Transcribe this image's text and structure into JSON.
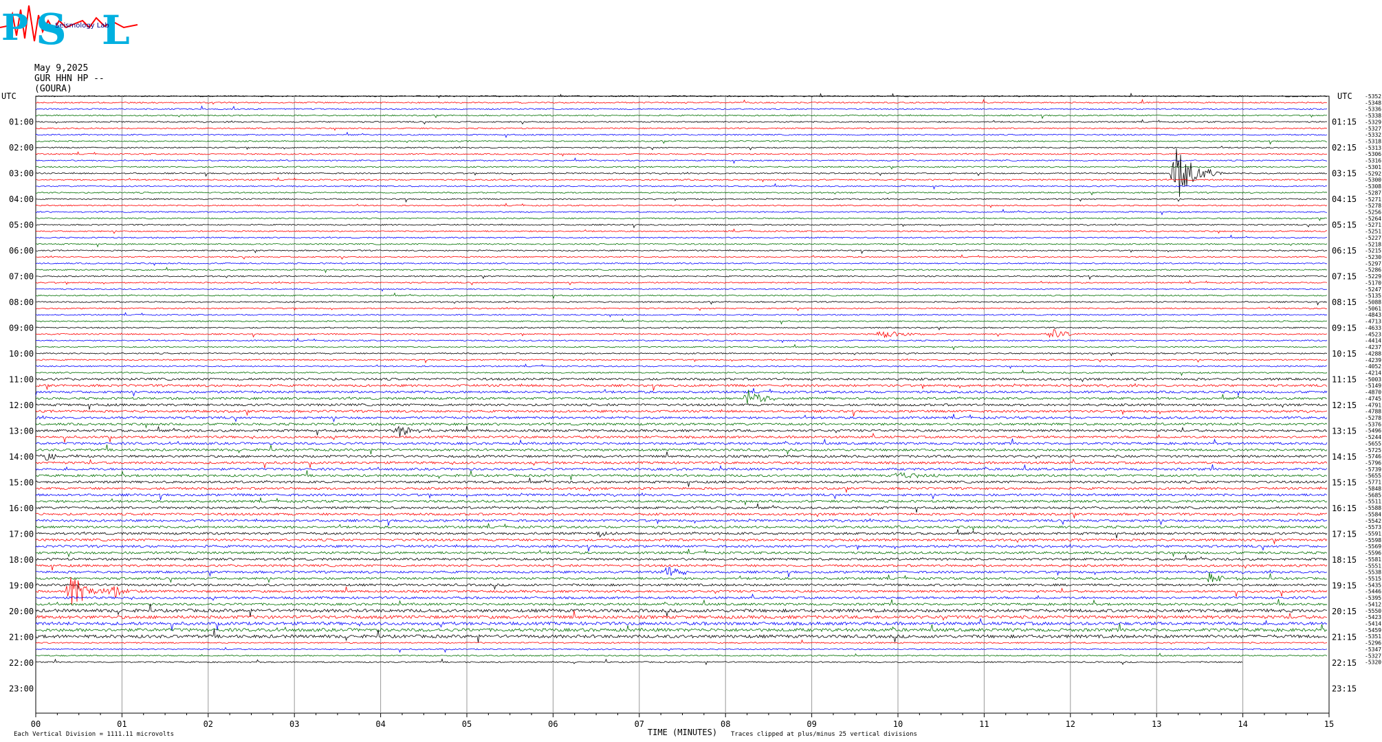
{
  "header": {
    "date": "May 9,2025",
    "station": "GUR HHN HP --",
    "site": "(GOURA)",
    "logo_text": "PSL",
    "logo_subtext": "Seismology Lab"
  },
  "axes": {
    "left_title": "UTC",
    "right_title": "UTC",
    "xlabel": "TIME (MINUTES)",
    "vertical_division_note": "Each Vertical Division = 1111.11 microvolts",
    "clip_note": "Traces clipped at plus/minus 25 vertical divisions"
  },
  "chart_data": {
    "type": "line",
    "title": "",
    "xlabel": "TIME (MINUTES)",
    "x_ticks": [
      "00",
      "01",
      "02",
      "03",
      "04",
      "05",
      "06",
      "07",
      "08",
      "09",
      "10",
      "11",
      "12",
      "13",
      "14",
      "15"
    ],
    "xlim": [
      0,
      15
    ],
    "grid": true,
    "left_hour_labels": [
      "01:00",
      "02:00",
      "03:00",
      "04:00",
      "05:00",
      "06:00",
      "07:00",
      "08:00",
      "09:00",
      "10:00",
      "11:00",
      "12:00",
      "13:00",
      "14:00",
      "15:00",
      "16:00",
      "17:00",
      "18:00",
      "19:00",
      "20:00",
      "21:00",
      "22:00",
      "23:00"
    ],
    "right_hour_labels": [
      "01:15",
      "02:15",
      "03:15",
      "04:15",
      "05:15",
      "06:15",
      "07:15",
      "08:15",
      "09:15",
      "10:15",
      "11:15",
      "12:15",
      "13:15",
      "14:15",
      "15:15",
      "16:15",
      "17:15",
      "18:15",
      "19:15",
      "20:15",
      "21:15",
      "22:15",
      "23:15"
    ],
    "trace_colors": [
      "#000000",
      "#ff0000",
      "#0000ff",
      "#007000"
    ],
    "trace_offsets": [
      "-5352",
      "-5348",
      "-5336",
      "-5338",
      "-5329",
      "-5327",
      "-5332",
      "-5318",
      "-5313",
      "-5306",
      "-5316",
      "-5301",
      "-5292",
      "-5300",
      "-5308",
      "-5287",
      "-5271",
      "-5278",
      "-5256",
      "-5264",
      "-5271",
      "-5251",
      "-5227",
      "-5218",
      "-5215",
      "-5230",
      "-5297",
      "-5286",
      "-5229",
      "-5170",
      "-5247",
      "-5135",
      "-5088",
      "-5061",
      "-4843",
      "-4713",
      "-4633",
      "-4523",
      "-4414",
      "-4237",
      "-4288",
      "-4239",
      "-4052",
      "-4214",
      "-5003",
      "-5149",
      "-4870",
      "-4745",
      "-4791",
      "-4788",
      "-5278",
      "-5376",
      "-5496",
      "-5244",
      "-5655",
      "-5725",
      "-5746",
      "-5796",
      "-5739",
      "-5655",
      "-5771",
      "-5848",
      "-5685",
      "-5511",
      "-5588",
      "-5584",
      "-5542",
      "-5573",
      "-5591",
      "-5598",
      "-5569",
      "-5596",
      "-5581",
      "-5551",
      "-5538",
      "-5515",
      "-5435",
      "-5446",
      "-5395",
      "-5412",
      "-5550",
      "-5423",
      "-5414",
      "-5459",
      "-5351",
      "-5296",
      "-5347",
      "-5327",
      "-5320"
    ],
    "events": [
      {
        "minute": 13.2,
        "row": 12,
        "amp": 60,
        "label": "large earthquake"
      },
      {
        "minute": 8.25,
        "row": 47,
        "amp": 14
      },
      {
        "minute": 0.4,
        "row": 77,
        "amp": 30
      },
      {
        "minute": 0.9,
        "row": 77,
        "amp": 12
      },
      {
        "minute": 9.8,
        "row": 37,
        "amp": 9
      },
      {
        "minute": 11.75,
        "row": 37,
        "amp": 11
      },
      {
        "minute": 7.3,
        "row": 74,
        "amp": 10
      },
      {
        "minute": 6.5,
        "row": 68,
        "amp": 5
      },
      {
        "minute": 10.0,
        "row": 59,
        "amp": 8
      },
      {
        "minute": 13.6,
        "row": 75,
        "amp": 9
      },
      {
        "minute": 4.2,
        "row": 52,
        "amp": 10
      },
      {
        "minute": 0.1,
        "row": 56,
        "amp": 8
      }
    ]
  }
}
